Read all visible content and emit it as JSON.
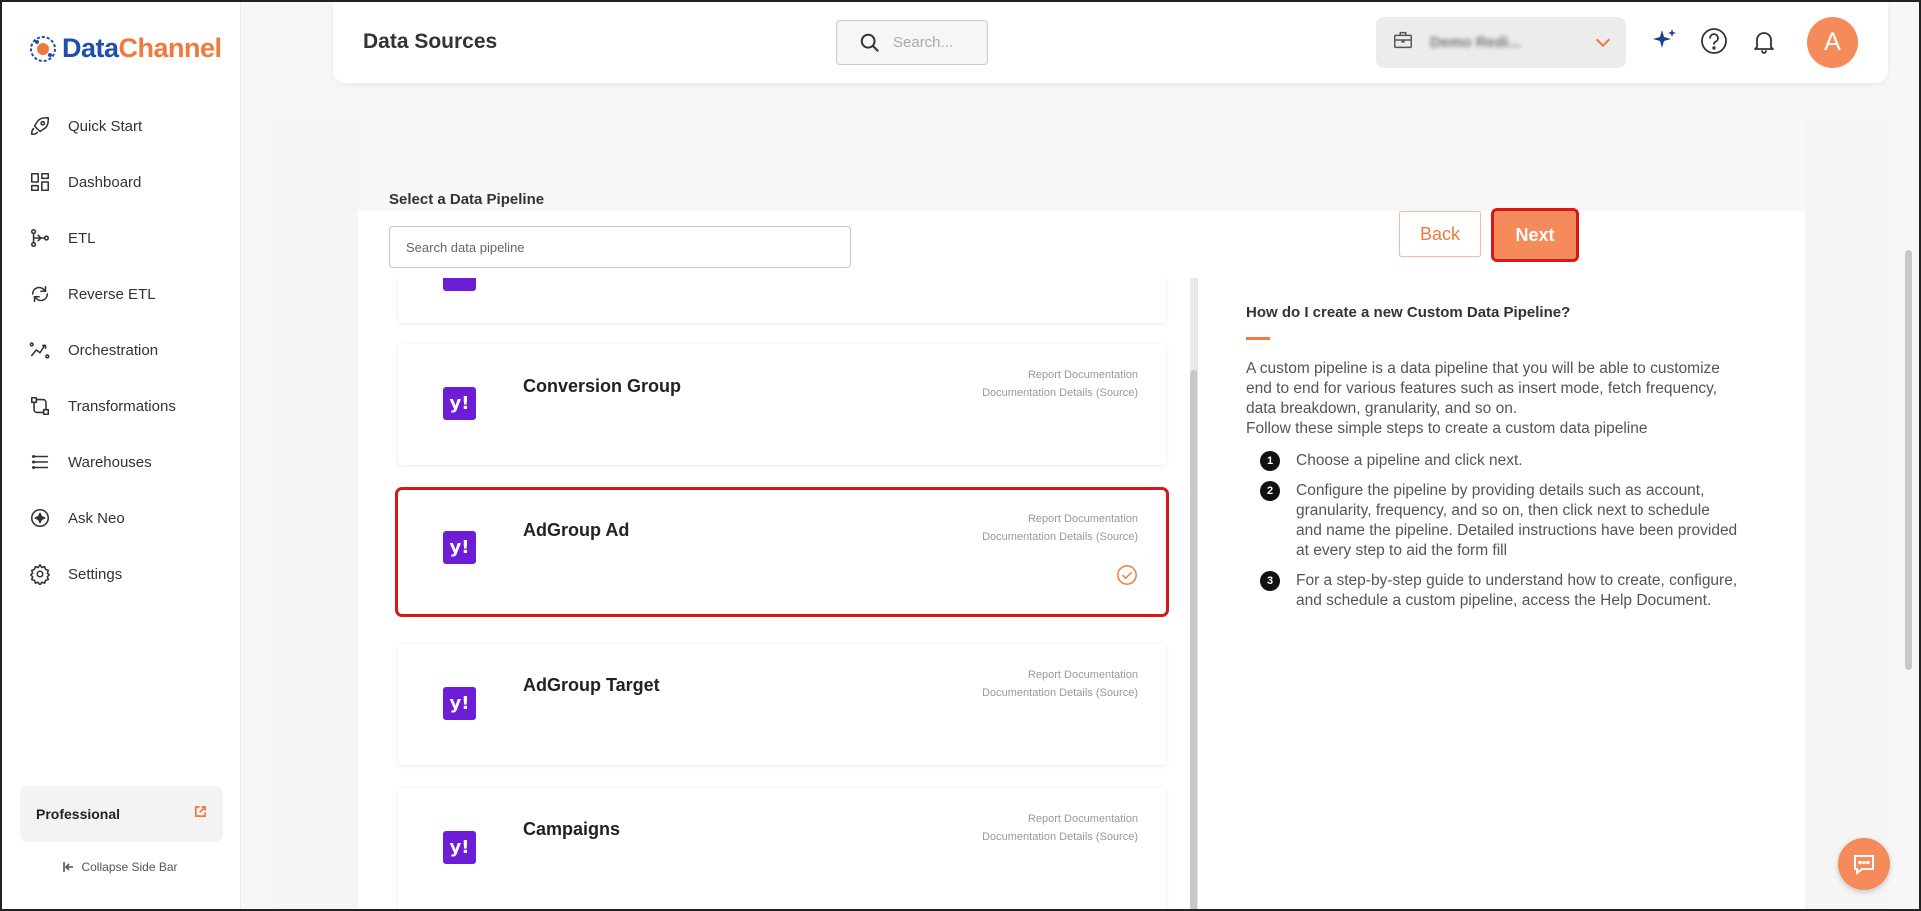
{
  "brand": {
    "name_part1": "Data",
    "name_part2": "Channel"
  },
  "sidebar": {
    "items": [
      {
        "label": "Quick Start",
        "icon": "rocket-icon"
      },
      {
        "label": "Dashboard",
        "icon": "dashboard-icon"
      },
      {
        "label": "ETL",
        "icon": "etl-icon"
      },
      {
        "label": "Reverse ETL",
        "icon": "reverse-etl-icon"
      },
      {
        "label": "Orchestration",
        "icon": "orchestration-icon"
      },
      {
        "label": "Transformations",
        "icon": "transformations-icon"
      },
      {
        "label": "Warehouses",
        "icon": "warehouses-icon"
      },
      {
        "label": "Ask Neo",
        "icon": "ask-neo-icon"
      },
      {
        "label": "Settings",
        "icon": "gear-icon"
      }
    ],
    "plan_label": "Professional",
    "collapse_label": "Collapse Side Bar"
  },
  "header": {
    "title": "Data Sources",
    "search_placeholder": "Search...",
    "account_name": "Demo Redi..."
  },
  "pipeline": {
    "select_label": "Select a Data Pipeline",
    "search_placeholder": "Search data pipeline",
    "back_label": "Back",
    "next_label": "Next",
    "logo_text": "y!",
    "link1": "Report Documentation",
    "link2": "Documentation Details (Source)",
    "items": [
      {
        "title": "Conversion Group"
      },
      {
        "title": "AdGroup Ad",
        "selected": true
      },
      {
        "title": "AdGroup Target"
      },
      {
        "title": "Campaigns"
      }
    ]
  },
  "help": {
    "title": "How do I create a new Custom Data Pipeline?",
    "intro": "A custom pipeline is a data pipeline that you will be able to customize end to end for various features such as insert mode, fetch frequency, data breakdown, granularity, and so on.",
    "intro2": "Follow these simple steps to create a custom data pipeline",
    "steps": [
      {
        "num": "1",
        "text": "Choose a pipeline and click next."
      },
      {
        "num": "2",
        "text": "Configure the pipeline by providing details such as account, granularity, frequency, and so on, then click next to schedule and name the pipeline. Detailed instructions have been provided at every step to aid the form fill"
      },
      {
        "num": "3",
        "text": "For a step-by-step guide to understand how to create, configure, and schedule a custom pipeline, access the Help Document."
      }
    ]
  },
  "colors": {
    "accent": "#f2793d",
    "brand_blue": "#1f4fa8",
    "yahoo_purple": "#6b1ed6",
    "highlight": "#d71818"
  }
}
